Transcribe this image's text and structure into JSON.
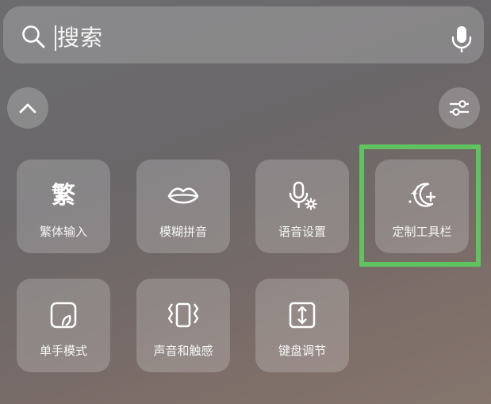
{
  "search": {
    "placeholder": "搜索"
  },
  "icons": {
    "search": "search-icon",
    "mic": "microphone-icon",
    "collapse": "chevron-up-icon",
    "settings": "sliders-icon"
  },
  "tiles": [
    {
      "label": "繁体输入",
      "icon": "traditional-char-icon",
      "glyph": "繁"
    },
    {
      "label": "模糊拼音",
      "icon": "lips-icon"
    },
    {
      "label": "语音设置",
      "icon": "mic-gear-icon"
    },
    {
      "label": "定制工具栏",
      "icon": "sparkle-moon-icon"
    },
    {
      "label": "单手模式",
      "icon": "one-hand-icon"
    },
    {
      "label": "声音和触感",
      "icon": "vibration-icon"
    },
    {
      "label": "键盘调节",
      "icon": "keyboard-adjust-icon"
    }
  ],
  "colors": {
    "highlight": "#5fc35f"
  }
}
